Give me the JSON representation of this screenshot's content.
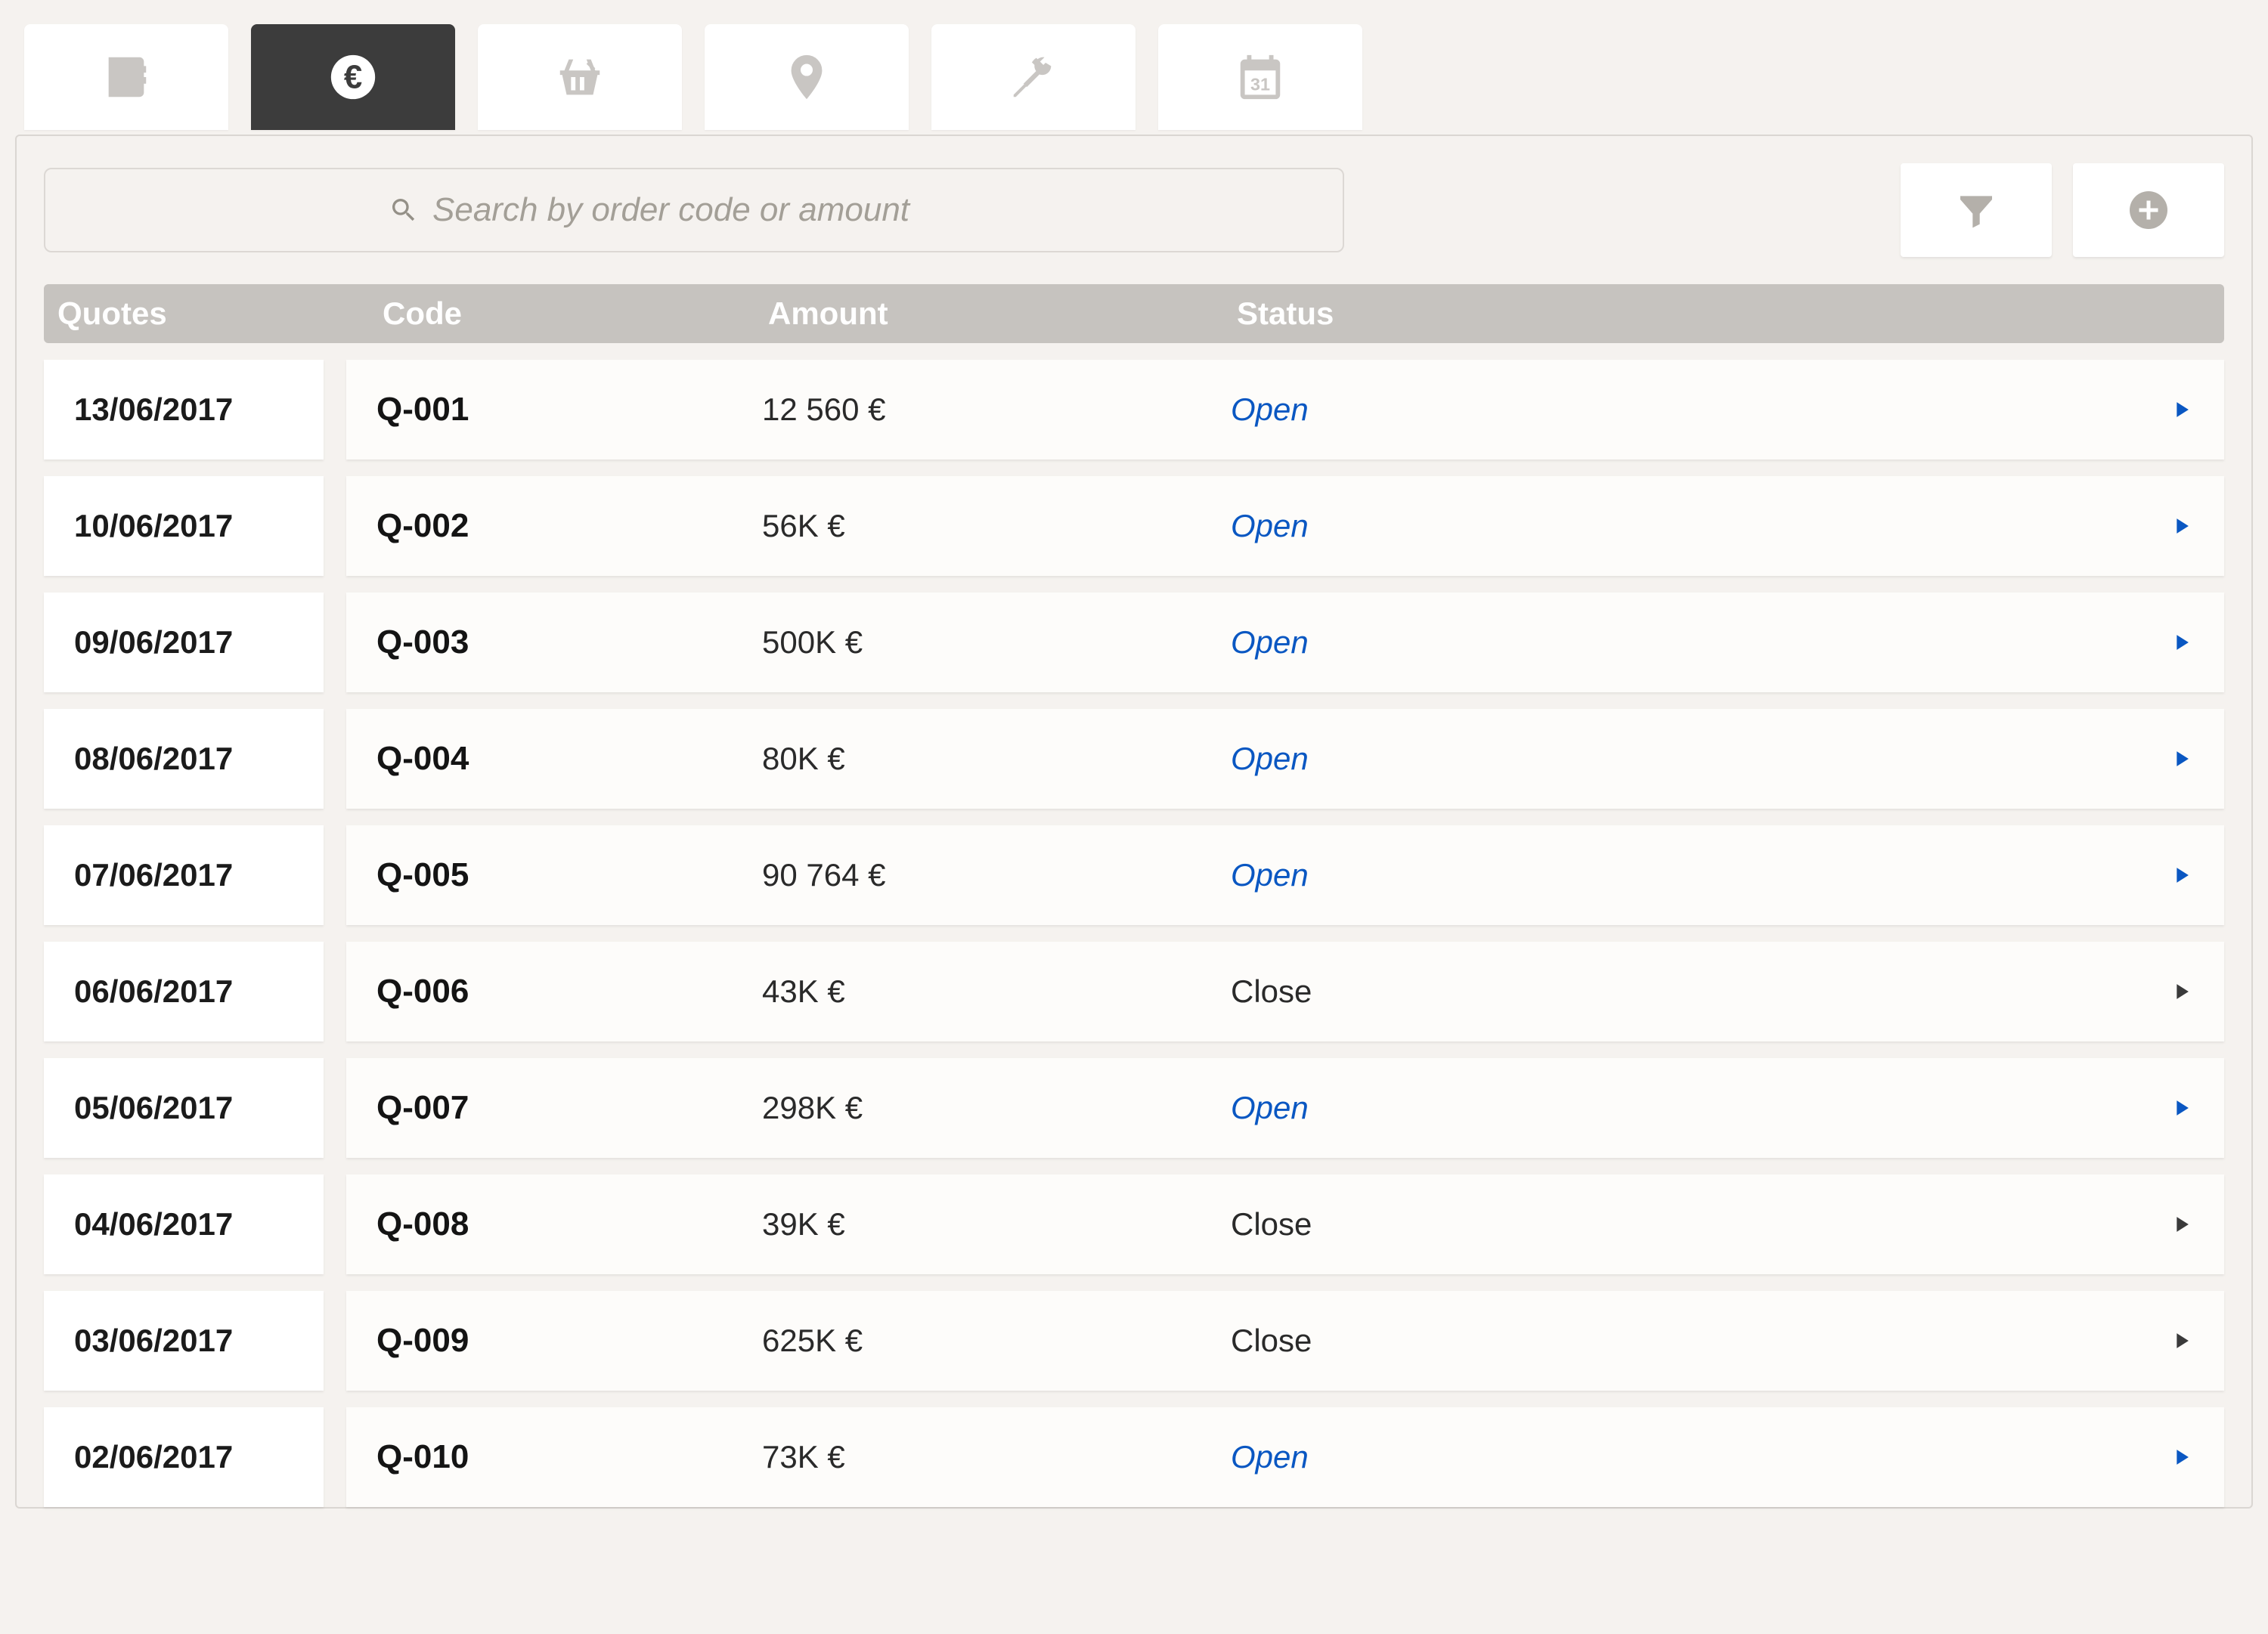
{
  "tabs": [
    {
      "icon": "contact",
      "active": false
    },
    {
      "icon": "euro",
      "active": true
    },
    {
      "icon": "basket",
      "active": false
    },
    {
      "icon": "location",
      "active": false
    },
    {
      "icon": "tools",
      "active": false
    },
    {
      "icon": "calendar",
      "active": false
    }
  ],
  "search": {
    "placeholder": "Search by order code or amount"
  },
  "headers": {
    "quotes": "Quotes",
    "code": "Code",
    "amount": "Amount",
    "status": "Status"
  },
  "status_labels": {
    "open": "Open",
    "close": "Close"
  },
  "rows": [
    {
      "date": "13/06/2017",
      "code": "Q-001",
      "amount": "12 560 €",
      "status": "open"
    },
    {
      "date": "10/06/2017",
      "code": "Q-002",
      "amount": "56K €",
      "status": "open"
    },
    {
      "date": "09/06/2017",
      "code": "Q-003",
      "amount": "500K €",
      "status": "open"
    },
    {
      "date": "08/06/2017",
      "code": "Q-004",
      "amount": "80K €",
      "status": "open"
    },
    {
      "date": "07/06/2017",
      "code": "Q-005",
      "amount": "90 764 €",
      "status": "open"
    },
    {
      "date": "06/06/2017",
      "code": "Q-006",
      "amount": "43K €",
      "status": "close"
    },
    {
      "date": "05/06/2017",
      "code": "Q-007",
      "amount": "298K €",
      "status": "open"
    },
    {
      "date": "04/06/2017",
      "code": "Q-008",
      "amount": "39K €",
      "status": "close"
    },
    {
      "date": "03/06/2017",
      "code": "Q-009",
      "amount": "625K €",
      "status": "close"
    },
    {
      "date": "02/06/2017",
      "code": "Q-010",
      "amount": "73K €",
      "status": "open"
    }
  ]
}
